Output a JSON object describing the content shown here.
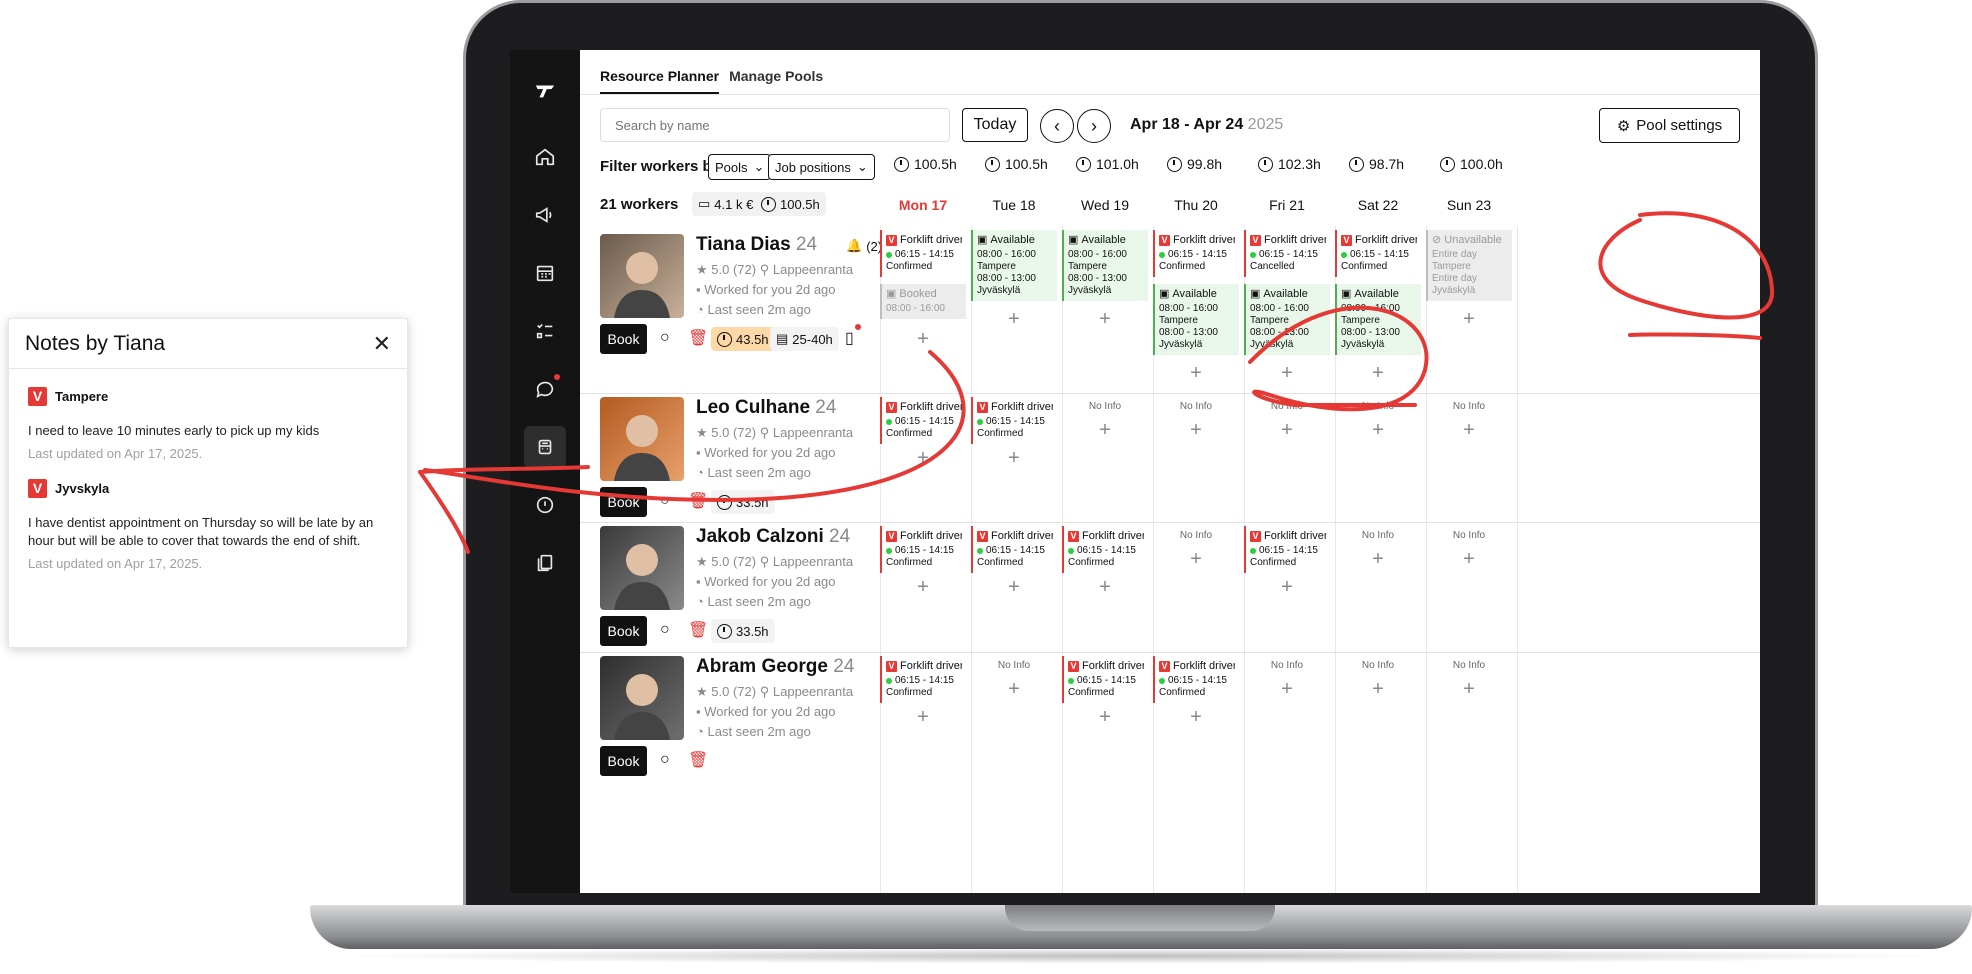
{
  "app": {
    "tabs": [
      {
        "label": "Resource Planner"
      },
      {
        "label": "Manage Pools"
      }
    ],
    "search_placeholder": "Search by name",
    "today_label": "Today",
    "date_range": "Apr 18 - Apr 24",
    "date_year": "2025",
    "pool_settings_label": "Pool settings",
    "filter_label": "Filter workers by",
    "filter_pools": "Pools",
    "filter_jobs": "Job positions",
    "workers_count": "21 workers",
    "total_cost": "4.1 k €",
    "total_hours": "100.5h"
  },
  "days": [
    {
      "label": "Mon 17",
      "hours": "100.5h",
      "today": true
    },
    {
      "label": "Tue 18",
      "hours": "100.5h"
    },
    {
      "label": "Wed 19",
      "hours": "101.0h"
    },
    {
      "label": "Thu 20",
      "hours": "99.8h"
    },
    {
      "label": "Fri 21",
      "hours": "102.3h"
    },
    {
      "label": "Sat 22",
      "hours": "98.7h"
    },
    {
      "label": "Sun 23",
      "hours": "100.0h"
    }
  ],
  "workers": [
    {
      "name": "Tiana Dias",
      "age": "24",
      "rating": "5.0 (72)",
      "city": "Lappeenranta",
      "worked": "Worked for you 2d ago",
      "seen": "Last seen 2m ago",
      "book": "Book",
      "hours": "43.5h",
      "range": "25-40h",
      "notif": "(2)"
    },
    {
      "name": "Leo Culhane",
      "age": "24",
      "rating": "5.0 (72)",
      "city": "Lappeenranta",
      "worked": "Worked for you 2d ago",
      "seen": "Last seen 2m ago",
      "book": "Book",
      "hours": "33.5h"
    },
    {
      "name": "Jakob Calzoni",
      "age": "24",
      "rating": "5.0 (72)",
      "city": "Lappeenranta",
      "worked": "Worked for you 2d ago",
      "seen": "Last seen 2m ago",
      "book": "Book",
      "hours": "33.5h"
    },
    {
      "name": "Abram George",
      "age": "24",
      "rating": "5.0 (72)",
      "city": "Lappeenranta",
      "worked": "Worked for you 2d ago",
      "seen": "Last seen 2m ago",
      "book": "Book",
      "hours": ""
    }
  ],
  "shift": {
    "forklift": "Forklift driver..",
    "time": "06:15 - 14:15",
    "confirmed": "Confirmed",
    "cancelled": "Cancelled",
    "available": "Available",
    "avail_t1": "08:00 - 16:00",
    "avail_c1": "Tampere",
    "avail_t2": "08:00 - 13:00",
    "avail_c2": "Jyväskylä",
    "booked": "Booked",
    "booked_time": "08:00 - 16:00",
    "unavailable": "Unavailable",
    "entire_day": "Entire day",
    "no_info": "No Info",
    "plus": "+"
  },
  "notes": {
    "title": "Notes by Tiana",
    "items": [
      {
        "location": "Tampere",
        "text": "I need to leave 10 minutes early to pick up my kids",
        "updated": "Last updated on Apr 17, 2025."
      },
      {
        "location": "Jyvskyla",
        "text": "I have dentist appointment on Thursday so will be late by an hour but will be able to cover that towards the end of shift.",
        "updated": "Last updated on Apr 17, 2025."
      }
    ]
  },
  "colors": {
    "accent": "#e53935",
    "available": "#e9f7ea",
    "confirmed_dot": "#2ecc40",
    "annotation": "#e53935"
  }
}
